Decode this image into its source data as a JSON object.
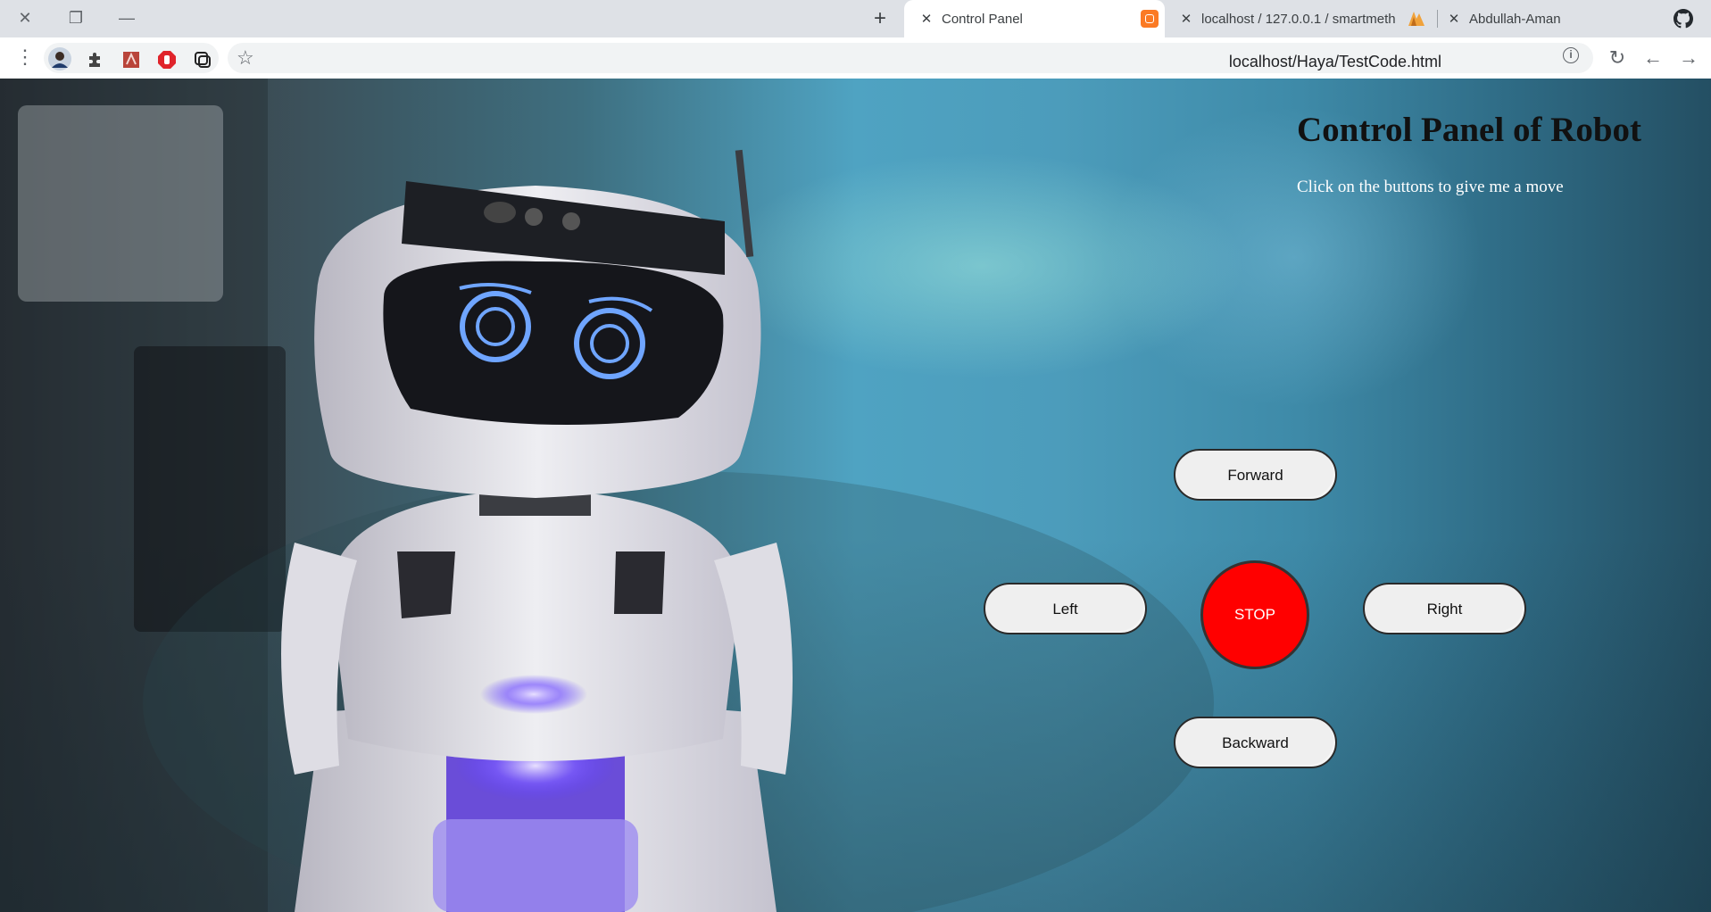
{
  "browser": {
    "tabs": [
      {
        "label": "Control Panel",
        "active": true
      },
      {
        "label": "localhost / 127.0.0.1 / smartmeth",
        "active": false
      },
      {
        "label": "Abdullah-Aman",
        "active": false
      }
    ],
    "new_tab_symbol": "+",
    "url": "localhost/Haya/TestCode.html",
    "icons": [
      "close-window-icon",
      "restore-icon",
      "minimize-icon",
      "puzzle-icon",
      "pdf-icon",
      "adblock-icon",
      "screenshot-icon",
      "star-icon",
      "info-icon",
      "reload-icon",
      "back-icon",
      "forward-icon",
      "github-icon"
    ]
  },
  "page": {
    "title": "Control Panel of Robot",
    "subtitle": "Click on the buttons to give me a move",
    "controls": {
      "forward": "Forward",
      "left": "Left",
      "stop": "STOP",
      "right": "Right",
      "backward": "Backward"
    },
    "colors": {
      "stop_button": "#ff0000",
      "button_face": "#efefef"
    }
  }
}
